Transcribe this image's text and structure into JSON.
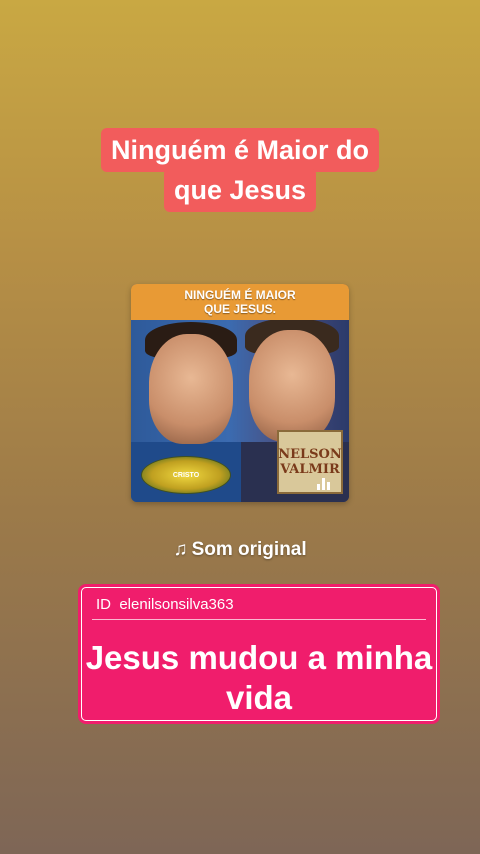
{
  "title": {
    "line1": "Ninguém é Maior do",
    "line2": "que Jesus"
  },
  "album": {
    "banner_line1": "NINGUÉM É MAIOR",
    "banner_line2": "QUE JESUS.",
    "name_line1": "NELSON",
    "name_line2": "VALMIR",
    "logo_text": "CRISTO",
    "equalizer_icon": "equalizer-icon"
  },
  "sound": {
    "icon": "music-note-icon",
    "label": "Som original"
  },
  "card": {
    "id_label": "ID",
    "id_value": "elenilsonsilva363",
    "message": "Jesus mudou a minha vida"
  },
  "colors": {
    "title_bg": "#f25c5c",
    "card_bg": "#f01d6c",
    "banner_bg": "#e89a35"
  }
}
